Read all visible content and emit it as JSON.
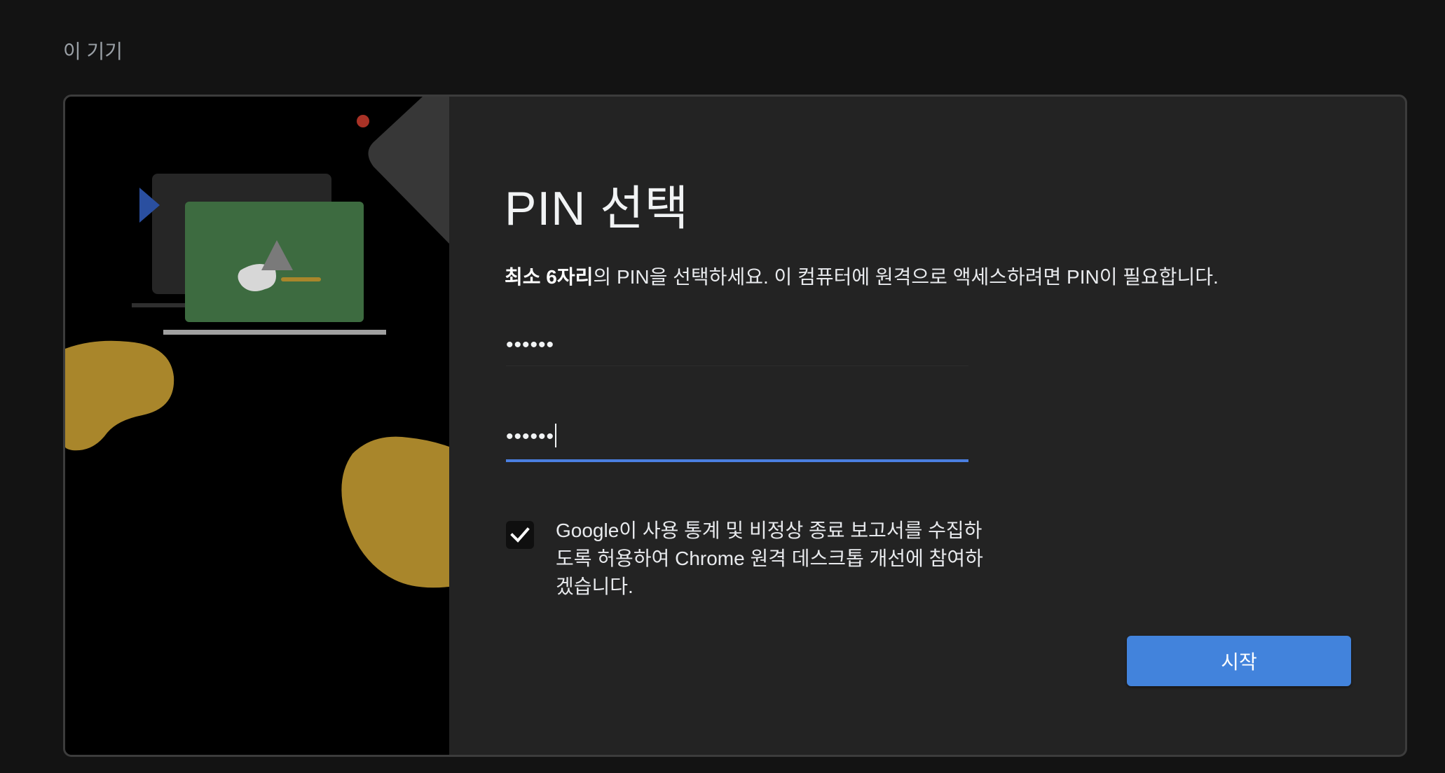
{
  "section_title": "이 기기",
  "dialog": {
    "heading": "PIN 선택",
    "description_bold": "최소 6자리",
    "description_rest": "의 PIN을 선택하세요. 이 컴퓨터에 원격으로 액세스하려면 PIN이 필요합니다.",
    "pin_field": {
      "value": "••••••"
    },
    "confirm_pin_field": {
      "value": "••••••"
    },
    "consent": {
      "checked": true,
      "label": "Google이 사용 통계 및 비정상 종료 보고서를 수집하도록 허용하여 Chrome 원격 데스크톱 개선에 참여하겠습니다."
    },
    "start_button_label": "시작"
  },
  "colors": {
    "accent": "#4283dc",
    "focus_underline": "#4a7fe0",
    "illustration_green": "#3d6b40",
    "illustration_gold": "#a9862b",
    "illustration_red": "#a93226",
    "illustration_blue": "#2a4fa0"
  }
}
